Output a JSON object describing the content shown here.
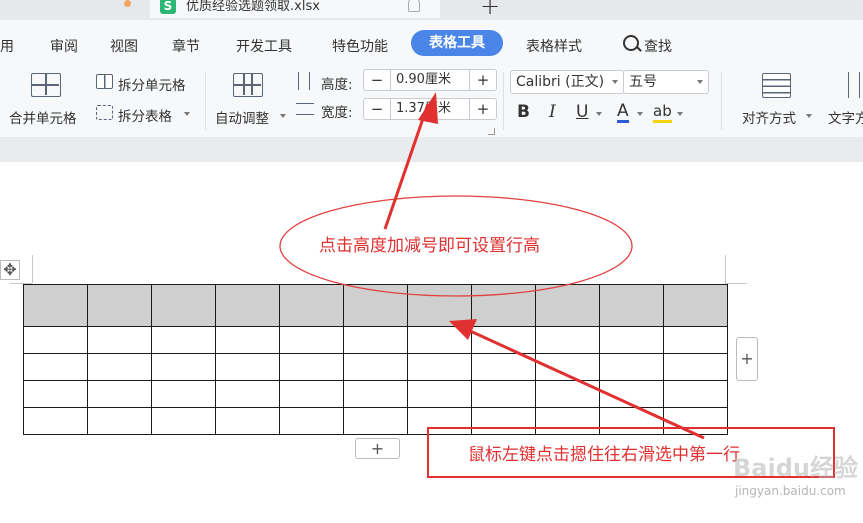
{
  "window": {
    "file_icon_letter": "S",
    "file_name": "优质经验选题领取.xlsx",
    "new_tab_symbol": "+"
  },
  "ribbon_tabs": [
    {
      "label": "用"
    },
    {
      "label": "审阅"
    },
    {
      "label": "视图"
    },
    {
      "label": "章节"
    },
    {
      "label": "开发工具"
    },
    {
      "label": "特色功能"
    },
    {
      "label": "表格工具",
      "active": true
    },
    {
      "label": "表格样式"
    },
    {
      "label": "查找"
    }
  ],
  "toolbar": {
    "merge_cells": "合并单元格",
    "split_cells": "拆分单元格",
    "split_table": "拆分表格",
    "auto_fit": "自动调整",
    "height_label": "高度:",
    "height_value": "0.90厘米",
    "width_label": "宽度:",
    "width_value": "1.37厘米",
    "minus": "−",
    "plus": "+",
    "font_name": "Calibri (正文)",
    "font_size": "五号",
    "bold": "B",
    "italic": "I",
    "underline": "U",
    "font_color": "A",
    "highlight": "ab",
    "align": "对齐方式",
    "text_dir": "文字方"
  },
  "document": {
    "table": {
      "rows": 5,
      "columns": 11
    },
    "move_handle_symbol": "✥",
    "add_symbol": "+"
  },
  "annotations": {
    "callout_top": "点击高度加减号即可设置行高",
    "callout_bottom": "鼠标左键点击摁住往右滑选中第一行",
    "color": "#e03030"
  },
  "watermark": {
    "main": "Baidu经验",
    "sub": "jingyan.baidu.com"
  },
  "colors": {
    "accent": "#4a86e8",
    "header_row": "#cfcfcf",
    "ribbon_bg": "#f7f8fa"
  }
}
